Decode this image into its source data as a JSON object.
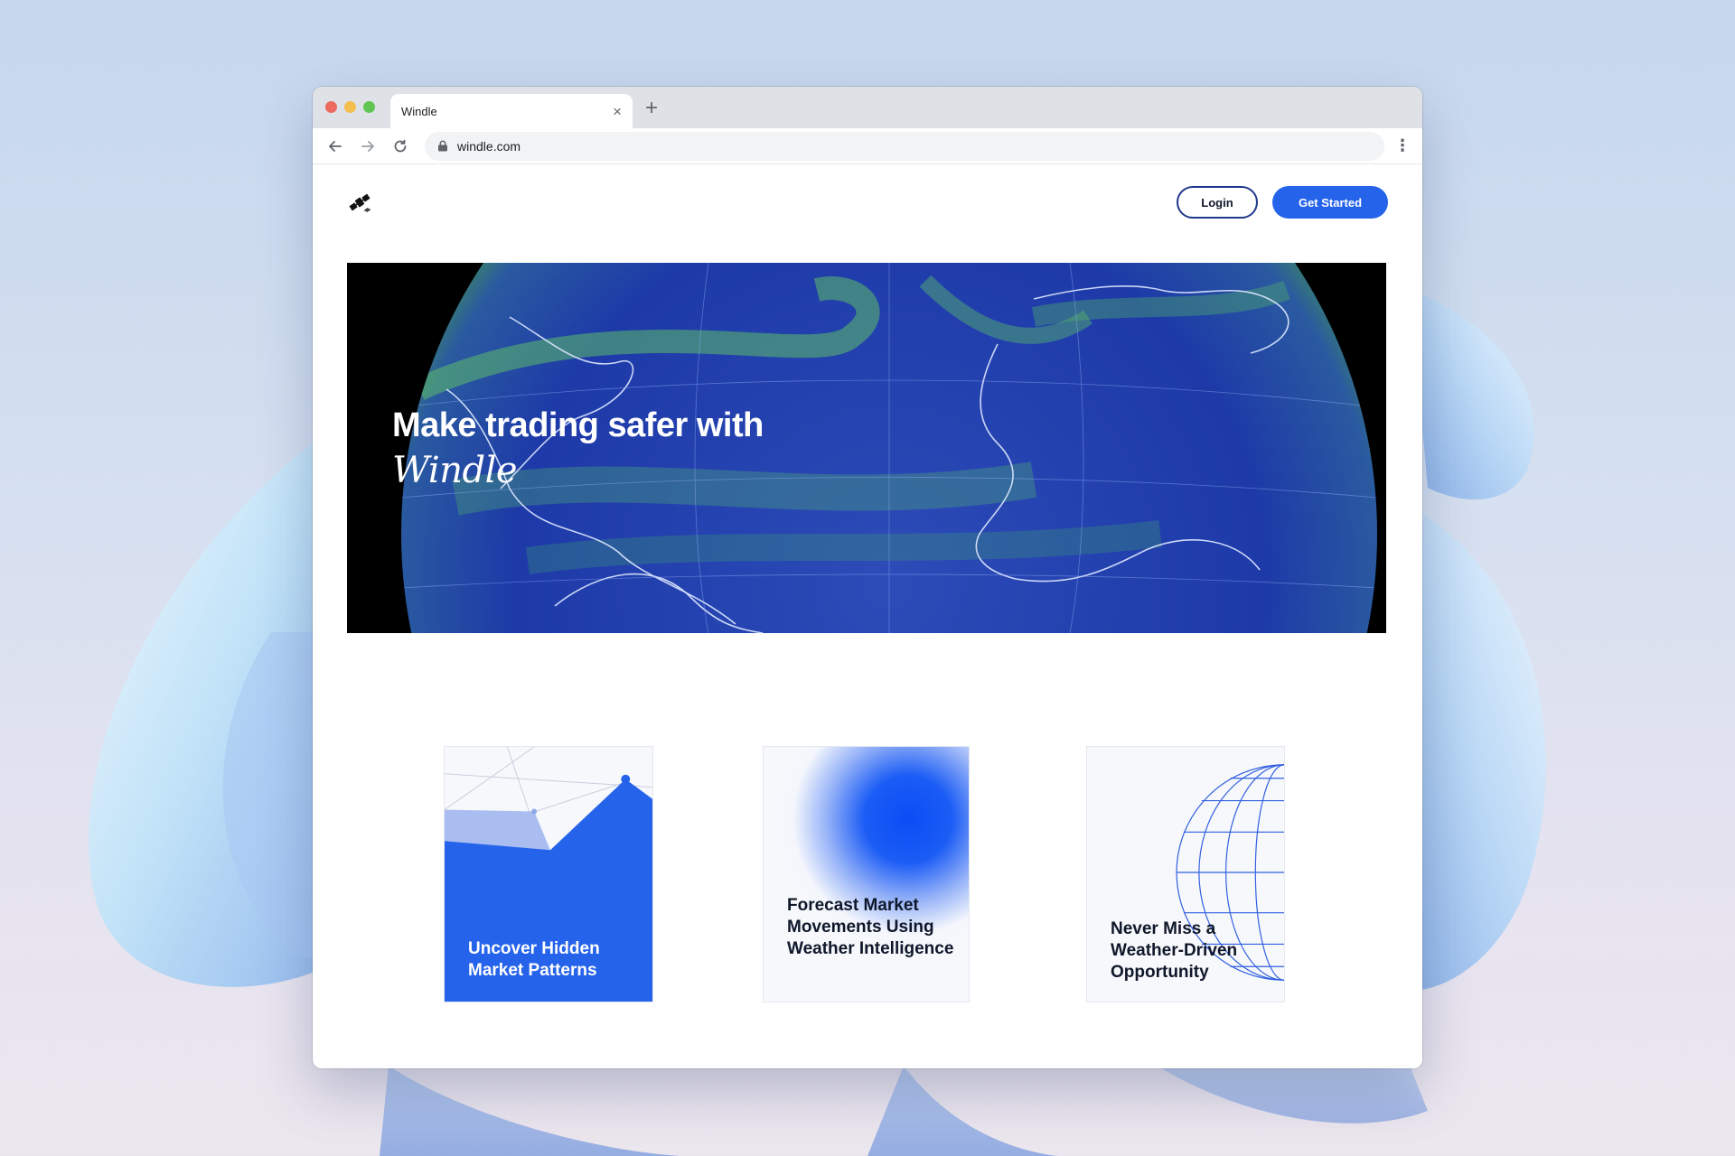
{
  "browser": {
    "tab_title": "Windle",
    "tab_close": "×",
    "new_tab": "+",
    "url": "windle.com",
    "menu": "⋮"
  },
  "header": {
    "logo_icon": "satellite-icon",
    "login_label": "Login",
    "get_started_label": "Get Started",
    "accent_color": "#2563eb"
  },
  "hero": {
    "title": "Make trading safer with",
    "brand": "Windle"
  },
  "cards": [
    {
      "title": "Uncover Hidden Market Patterns"
    },
    {
      "title": "Forecast Market Movements Using Weather Intelligence"
    },
    {
      "title": "Never Miss a Weather-Driven Opportunity"
    }
  ]
}
